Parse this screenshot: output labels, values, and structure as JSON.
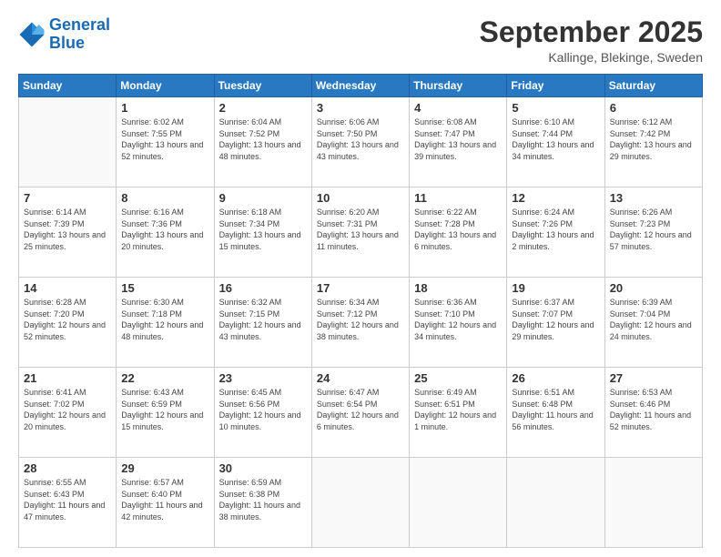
{
  "header": {
    "logo_line1": "General",
    "logo_line2": "Blue",
    "month": "September 2025",
    "location": "Kallinge, Blekinge, Sweden"
  },
  "weekdays": [
    "Sunday",
    "Monday",
    "Tuesday",
    "Wednesday",
    "Thursday",
    "Friday",
    "Saturday"
  ],
  "weeks": [
    [
      {
        "day": "",
        "sunrise": "",
        "sunset": "",
        "daylight": ""
      },
      {
        "day": "1",
        "sunrise": "Sunrise: 6:02 AM",
        "sunset": "Sunset: 7:55 PM",
        "daylight": "Daylight: 13 hours and 52 minutes."
      },
      {
        "day": "2",
        "sunrise": "Sunrise: 6:04 AM",
        "sunset": "Sunset: 7:52 PM",
        "daylight": "Daylight: 13 hours and 48 minutes."
      },
      {
        "day": "3",
        "sunrise": "Sunrise: 6:06 AM",
        "sunset": "Sunset: 7:50 PM",
        "daylight": "Daylight: 13 hours and 43 minutes."
      },
      {
        "day": "4",
        "sunrise": "Sunrise: 6:08 AM",
        "sunset": "Sunset: 7:47 PM",
        "daylight": "Daylight: 13 hours and 39 minutes."
      },
      {
        "day": "5",
        "sunrise": "Sunrise: 6:10 AM",
        "sunset": "Sunset: 7:44 PM",
        "daylight": "Daylight: 13 hours and 34 minutes."
      },
      {
        "day": "6",
        "sunrise": "Sunrise: 6:12 AM",
        "sunset": "Sunset: 7:42 PM",
        "daylight": "Daylight: 13 hours and 29 minutes."
      }
    ],
    [
      {
        "day": "7",
        "sunrise": "Sunrise: 6:14 AM",
        "sunset": "Sunset: 7:39 PM",
        "daylight": "Daylight: 13 hours and 25 minutes."
      },
      {
        "day": "8",
        "sunrise": "Sunrise: 6:16 AM",
        "sunset": "Sunset: 7:36 PM",
        "daylight": "Daylight: 13 hours and 20 minutes."
      },
      {
        "day": "9",
        "sunrise": "Sunrise: 6:18 AM",
        "sunset": "Sunset: 7:34 PM",
        "daylight": "Daylight: 13 hours and 15 minutes."
      },
      {
        "day": "10",
        "sunrise": "Sunrise: 6:20 AM",
        "sunset": "Sunset: 7:31 PM",
        "daylight": "Daylight: 13 hours and 11 minutes."
      },
      {
        "day": "11",
        "sunrise": "Sunrise: 6:22 AM",
        "sunset": "Sunset: 7:28 PM",
        "daylight": "Daylight: 13 hours and 6 minutes."
      },
      {
        "day": "12",
        "sunrise": "Sunrise: 6:24 AM",
        "sunset": "Sunset: 7:26 PM",
        "daylight": "Daylight: 13 hours and 2 minutes."
      },
      {
        "day": "13",
        "sunrise": "Sunrise: 6:26 AM",
        "sunset": "Sunset: 7:23 PM",
        "daylight": "Daylight: 12 hours and 57 minutes."
      }
    ],
    [
      {
        "day": "14",
        "sunrise": "Sunrise: 6:28 AM",
        "sunset": "Sunset: 7:20 PM",
        "daylight": "Daylight: 12 hours and 52 minutes."
      },
      {
        "day": "15",
        "sunrise": "Sunrise: 6:30 AM",
        "sunset": "Sunset: 7:18 PM",
        "daylight": "Daylight: 12 hours and 48 minutes."
      },
      {
        "day": "16",
        "sunrise": "Sunrise: 6:32 AM",
        "sunset": "Sunset: 7:15 PM",
        "daylight": "Daylight: 12 hours and 43 minutes."
      },
      {
        "day": "17",
        "sunrise": "Sunrise: 6:34 AM",
        "sunset": "Sunset: 7:12 PM",
        "daylight": "Daylight: 12 hours and 38 minutes."
      },
      {
        "day": "18",
        "sunrise": "Sunrise: 6:36 AM",
        "sunset": "Sunset: 7:10 PM",
        "daylight": "Daylight: 12 hours and 34 minutes."
      },
      {
        "day": "19",
        "sunrise": "Sunrise: 6:37 AM",
        "sunset": "Sunset: 7:07 PM",
        "daylight": "Daylight: 12 hours and 29 minutes."
      },
      {
        "day": "20",
        "sunrise": "Sunrise: 6:39 AM",
        "sunset": "Sunset: 7:04 PM",
        "daylight": "Daylight: 12 hours and 24 minutes."
      }
    ],
    [
      {
        "day": "21",
        "sunrise": "Sunrise: 6:41 AM",
        "sunset": "Sunset: 7:02 PM",
        "daylight": "Daylight: 12 hours and 20 minutes."
      },
      {
        "day": "22",
        "sunrise": "Sunrise: 6:43 AM",
        "sunset": "Sunset: 6:59 PM",
        "daylight": "Daylight: 12 hours and 15 minutes."
      },
      {
        "day": "23",
        "sunrise": "Sunrise: 6:45 AM",
        "sunset": "Sunset: 6:56 PM",
        "daylight": "Daylight: 12 hours and 10 minutes."
      },
      {
        "day": "24",
        "sunrise": "Sunrise: 6:47 AM",
        "sunset": "Sunset: 6:54 PM",
        "daylight": "Daylight: 12 hours and 6 minutes."
      },
      {
        "day": "25",
        "sunrise": "Sunrise: 6:49 AM",
        "sunset": "Sunset: 6:51 PM",
        "daylight": "Daylight: 12 hours and 1 minute."
      },
      {
        "day": "26",
        "sunrise": "Sunrise: 6:51 AM",
        "sunset": "Sunset: 6:48 PM",
        "daylight": "Daylight: 11 hours and 56 minutes."
      },
      {
        "day": "27",
        "sunrise": "Sunrise: 6:53 AM",
        "sunset": "Sunset: 6:46 PM",
        "daylight": "Daylight: 11 hours and 52 minutes."
      }
    ],
    [
      {
        "day": "28",
        "sunrise": "Sunrise: 6:55 AM",
        "sunset": "Sunset: 6:43 PM",
        "daylight": "Daylight: 11 hours and 47 minutes."
      },
      {
        "day": "29",
        "sunrise": "Sunrise: 6:57 AM",
        "sunset": "Sunset: 6:40 PM",
        "daylight": "Daylight: 11 hours and 42 minutes."
      },
      {
        "day": "30",
        "sunrise": "Sunrise: 6:59 AM",
        "sunset": "Sunset: 6:38 PM",
        "daylight": "Daylight: 11 hours and 38 minutes."
      },
      {
        "day": "",
        "sunrise": "",
        "sunset": "",
        "daylight": ""
      },
      {
        "day": "",
        "sunrise": "",
        "sunset": "",
        "daylight": ""
      },
      {
        "day": "",
        "sunrise": "",
        "sunset": "",
        "daylight": ""
      },
      {
        "day": "",
        "sunrise": "",
        "sunset": "",
        "daylight": ""
      }
    ]
  ]
}
